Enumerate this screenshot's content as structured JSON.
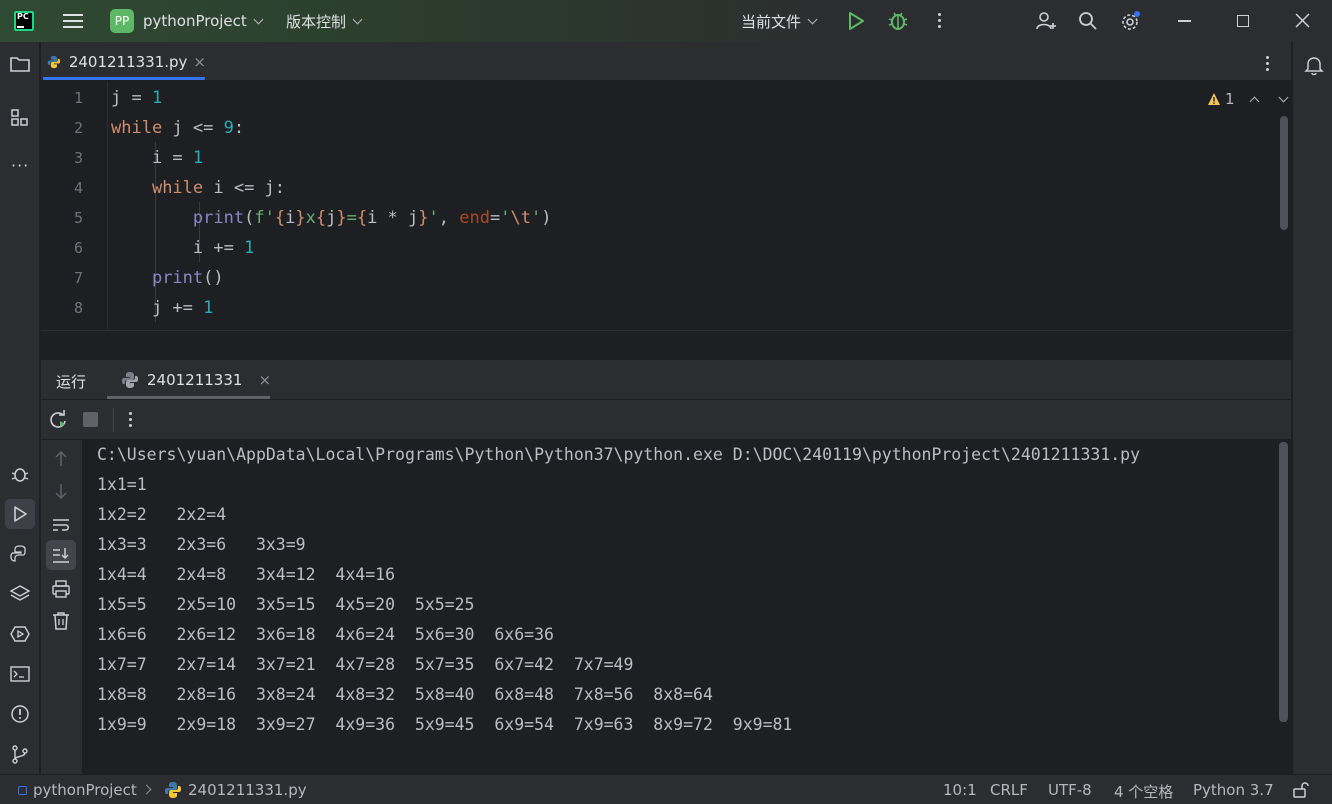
{
  "titlebar": {
    "project_badge": "PP",
    "project_name": "pythonProject",
    "vcs_label": "版本控制",
    "run_config": "当前文件"
  },
  "editor_tab": {
    "filename": "2401211331.py",
    "close": "×"
  },
  "editor": {
    "warning_count": "1",
    "line_numbers": [
      "1",
      "2",
      "3",
      "4",
      "5",
      "6",
      "7",
      "8"
    ]
  },
  "run_panel": {
    "title": "运行",
    "tab_label": "2401211331",
    "close": "×"
  },
  "console": {
    "command": "C:\\Users\\yuan\\AppData\\Local\\Programs\\Python\\Python37\\python.exe D:\\DOC\\240119\\pythonProject\\2401211331.py",
    "lines": [
      "1x1=1",
      "1x2=2   2x2=4",
      "1x3=3   2x3=6   3x3=9",
      "1x4=4   2x4=8   3x4=12  4x4=16",
      "1x5=5   2x5=10  3x5=15  4x5=20  5x5=25",
      "1x6=6   2x6=12  3x6=18  4x6=24  5x6=30  6x6=36",
      "1x7=7   2x7=14  3x7=21  4x7=28  5x7=35  6x7=42  7x7=49",
      "1x8=8   2x8=16  3x8=24  4x8=32  5x8=40  6x8=48  7x8=56  8x8=64",
      "1x9=9   2x9=18  3x9=27  4x9=36  5x9=45  6x9=54  7x9=63  8x9=72  9x9=81"
    ]
  },
  "statusbar": {
    "breadcrumb_project": "pythonProject",
    "breadcrumb_file": "2401211331.py",
    "position": "10:1",
    "line_ending": "CRLF",
    "encoding": "UTF-8",
    "indent": "4 个空格",
    "interpreter": "Python 3.7"
  },
  "colors": {
    "accent": "#3574f0",
    "run_green": "#5fb865",
    "keyword": "#cf8e6d",
    "number": "#2aacb8",
    "string": "#6aab73"
  }
}
